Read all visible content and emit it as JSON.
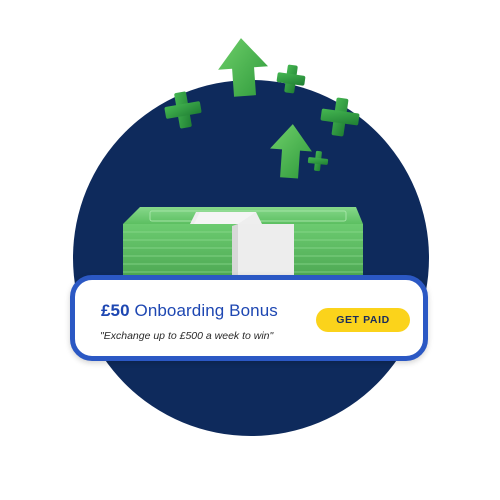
{
  "promo": {
    "amount": "£50",
    "title_rest": " Onboarding Bonus",
    "subtitle": "\"Exchange up to £500 a week to win\"",
    "cta_label": "GET PAID"
  },
  "colors": {
    "circle": "#0e2a5c",
    "card_border": "#2b58c4",
    "title": "#1e47b2",
    "cta_bg": "#fbd31b",
    "money_green": "#63c267",
    "arrow_green": "#4caf50",
    "plus_green": "#2e9e43"
  },
  "icons": [
    "up-arrow-icon",
    "plus-icon",
    "cash-stack-illustration"
  ]
}
